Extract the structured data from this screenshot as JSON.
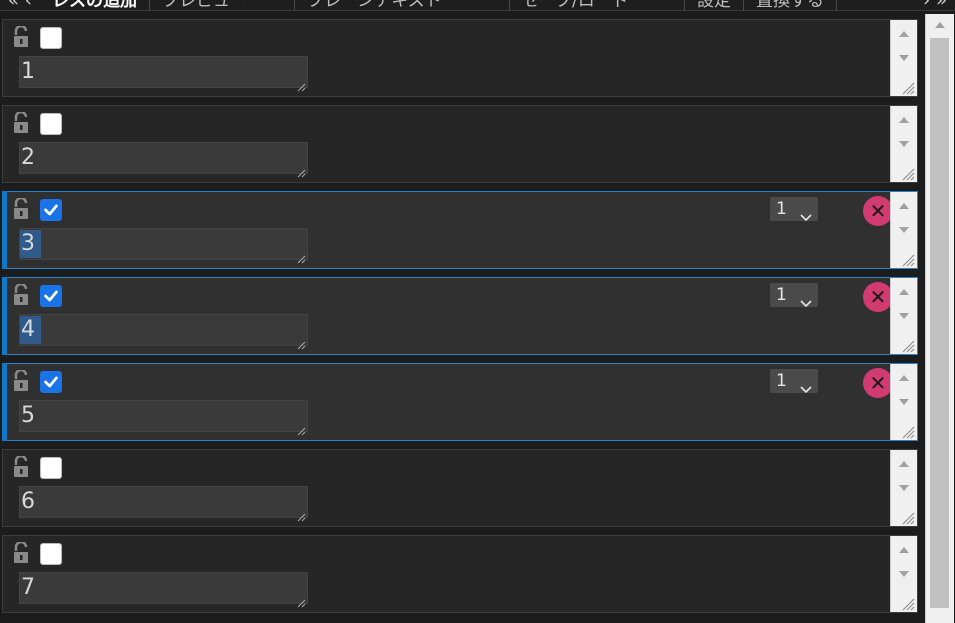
{
  "tabs": {
    "nav_left": "«  ‹",
    "items": [
      {
        "label": "レスの追加",
        "active": true
      },
      {
        "label": "プレビュー",
        "active": false
      },
      {
        "label": "プレーンテキスト",
        "active": false
      },
      {
        "label": "セーブ/ロード",
        "active": false
      },
      {
        "label": "設定",
        "active": false
      },
      {
        "label": "置換する",
        "active": false
      }
    ],
    "nav_right": "›  »"
  },
  "rows": [
    {
      "text": "1",
      "checked": false,
      "count": null
    },
    {
      "text": "2",
      "checked": false,
      "count": null
    },
    {
      "text": "3",
      "checked": true,
      "count": "1"
    },
    {
      "text": "4",
      "checked": true,
      "count": "1"
    },
    {
      "text": "5",
      "checked": true,
      "count": "1"
    },
    {
      "text": "6",
      "checked": false,
      "count": null
    },
    {
      "text": "7",
      "checked": false,
      "count": null
    }
  ],
  "icons": {
    "lock": "unlocked-padlock-icon",
    "delete": "close-icon",
    "select_caret": "chevron-down-icon"
  },
  "delete_glyph": "✕",
  "colors": {
    "accent": "#1478c8",
    "checkbox_on": "#1a73e8",
    "delete_button": "#d13b6f",
    "row_bg": "#262626",
    "row_checked_bg": "#303030"
  }
}
